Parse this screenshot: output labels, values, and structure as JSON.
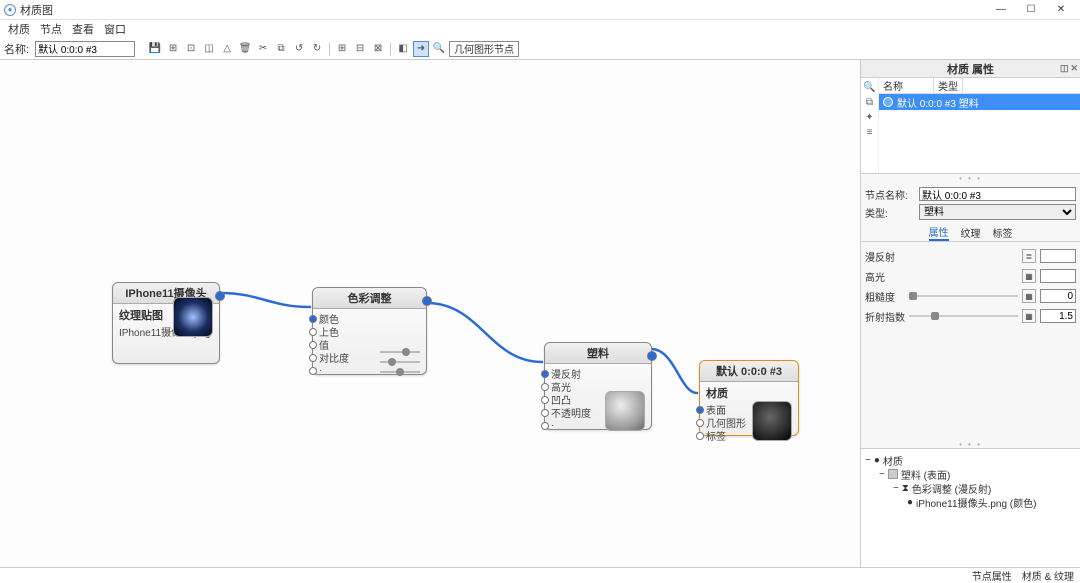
{
  "window": {
    "title": "材质图"
  },
  "menu": {
    "m1": "材质",
    "m2": "节点",
    "m3": "查看",
    "m4": "窗口"
  },
  "toolbar": {
    "name_label": "名称:",
    "name_value": "默认 0:0:0 #3",
    "geom_label": "几何图形节点"
  },
  "panel": {
    "title": "材质 属性",
    "col_name": "名称",
    "col_type": "类型",
    "row_text": "默认 0:0:0 #3 塑料",
    "node_name_label": "节点名称:",
    "node_name_value": "默认 0:0:0 #3",
    "type_label": "类型:",
    "type_value": "塑料",
    "tabs": {
      "t1": "属性",
      "t2": "纹理",
      "t3": "标签"
    },
    "props": {
      "p1": "漫反射",
      "p2": "高光",
      "p3": "粗糙度",
      "p3v": "0",
      "p4": "折射指数",
      "p4v": "1.5"
    }
  },
  "tree": {
    "n1": "材质",
    "n2": "塑料 (表面)",
    "n3": "色彩调整 (漫反射)",
    "n4": "iPhone11摄像头.png (颜色)"
  },
  "status": {
    "s1": "节点属性",
    "s2": "材质 & 纹理"
  },
  "nodes": {
    "n1": {
      "title": "IPhone11摄像头",
      "sub": "纹理贴图",
      "line": "IPhone11摄像头.png"
    },
    "n2": {
      "title": "色彩调整",
      "p1": "颜色",
      "p2": "上色",
      "p3": "值",
      "p4": "对比度",
      "p5": "·"
    },
    "n3": {
      "title": "塑料",
      "p1": "漫反射",
      "p2": "高光",
      "p3": "凹凸",
      "p4": "不透明度",
      "p5": "·"
    },
    "n4": {
      "title": "默认 0:0:0 #3",
      "sub": "材质",
      "p1": "表面",
      "p2": "几何图形",
      "p3": "标签"
    }
  },
  "chart_data": null
}
